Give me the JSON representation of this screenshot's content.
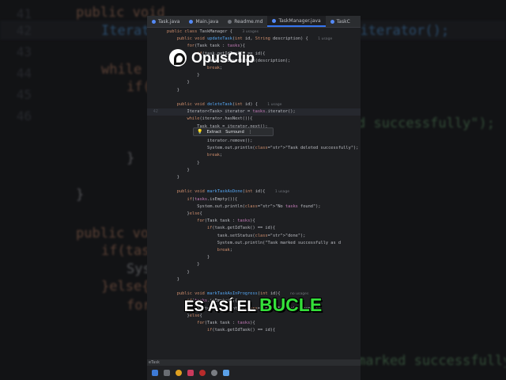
{
  "tabs": [
    {
      "label": "Task.java",
      "kind": "java",
      "active": false
    },
    {
      "label": "Main.java",
      "kind": "java",
      "active": false
    },
    {
      "label": "Readme.md",
      "kind": "md",
      "active": false
    },
    {
      "label": "TaskManager.java",
      "kind": "java",
      "active": true
    },
    {
      "label": "TaskC",
      "kind": "java",
      "active": false
    }
  ],
  "code_lines": [
    {
      "n": "",
      "t": "public class TaskManager {  3 usages"
    },
    {
      "n": "",
      "t": "    public void updateTask(int id, String description) {  1 usage"
    },
    {
      "n": "",
      "t": "        for(Task task : tasks){"
    },
    {
      "n": "",
      "t": "            if(task.getIdTask() == id){"
    },
    {
      "n": "",
      "t": "                task.setDescription(description);"
    },
    {
      "n": "",
      "t": "                break;"
    },
    {
      "n": "",
      "t": "            }"
    },
    {
      "n": "",
      "t": "        }"
    },
    {
      "n": "",
      "t": "    }"
    },
    {
      "n": "",
      "t": ""
    },
    {
      "n": "",
      "t": "    public void deleteTask(int id) {  1 usage"
    },
    {
      "n": "42",
      "t": "        Iterator<Task> iterator = tasks.iterator();",
      "cur": true
    },
    {
      "n": "",
      "t": "        while(iterator.hasNext()){"
    },
    {
      "n": "",
      "t": "            Task task = iterator.next();"
    },
    {
      "n": "",
      "t": "            if(task.getIdTask() == id){"
    },
    {
      "n": "",
      "t": "                iterator.remove();"
    },
    {
      "n": "",
      "t": "                System.out.println(\"Task deleted successfully\");"
    },
    {
      "n": "",
      "t": "                break;"
    },
    {
      "n": "",
      "t": "            }"
    },
    {
      "n": "",
      "t": "        }"
    },
    {
      "n": "",
      "t": "    }"
    },
    {
      "n": "",
      "t": ""
    },
    {
      "n": "",
      "t": "    public void markTaskAsDone(int id){  1 usage"
    },
    {
      "n": "",
      "t": "        if(tasks.isEmpty()){"
    },
    {
      "n": "",
      "t": "            System.out.println(\"No tasks found\");"
    },
    {
      "n": "",
      "t": "        }else{"
    },
    {
      "n": "",
      "t": "            for(Task task : tasks){"
    },
    {
      "n": "",
      "t": "                if(task.getIdTask() == id){"
    },
    {
      "n": "",
      "t": "                    task.setStatus(\"done\");"
    },
    {
      "n": "",
      "t": "                    System.out.println(\"Task marked successfully as d"
    },
    {
      "n": "",
      "t": "                    break;"
    },
    {
      "n": "",
      "t": "                }"
    },
    {
      "n": "",
      "t": "            }"
    },
    {
      "n": "",
      "t": "        }"
    },
    {
      "n": "",
      "t": "    }"
    },
    {
      "n": "",
      "t": ""
    },
    {
      "n": "",
      "t": "    public void markTaskAsInProgress(int id){  no usages"
    },
    {
      "n": "",
      "t": "        if(tasks.isEmpty()){"
    },
    {
      "n": "",
      "t": "            System.out.println(\"No tasks found\");"
    },
    {
      "n": "",
      "t": "        }else{"
    },
    {
      "n": "",
      "t": "            for(Task task : tasks){"
    },
    {
      "n": "",
      "t": "                if(task.getIdTask() == id){"
    }
  ],
  "popup": {
    "extract": "Extract",
    "surround": "Surround",
    "more": "⋮"
  },
  "status_text": "eTask",
  "overlay": {
    "logo_text": "OpusClip",
    "caption_white": "ES ASÍ EL",
    "caption_green": "BUCLE"
  },
  "background": {
    "line_numbers": [
      "41",
      "42",
      "43",
      "44",
      "45",
      "46"
    ],
    "lines": [
      "public void",
      "Iterator<Task> iterator = tasks.iterator();",
      "while",
      "if(",
      "d successfully\");",
      "}",
      "}",
      "public void",
      "if(task",
      "System",
      "}else{",
      "for(",
      "marked successfully as d"
    ]
  },
  "colors": {
    "keyword": "#cf8e6d",
    "function": "#56a8f5",
    "string": "#6aab73",
    "accent_green": "#35e03a",
    "tab_underline": "#3574f0"
  }
}
